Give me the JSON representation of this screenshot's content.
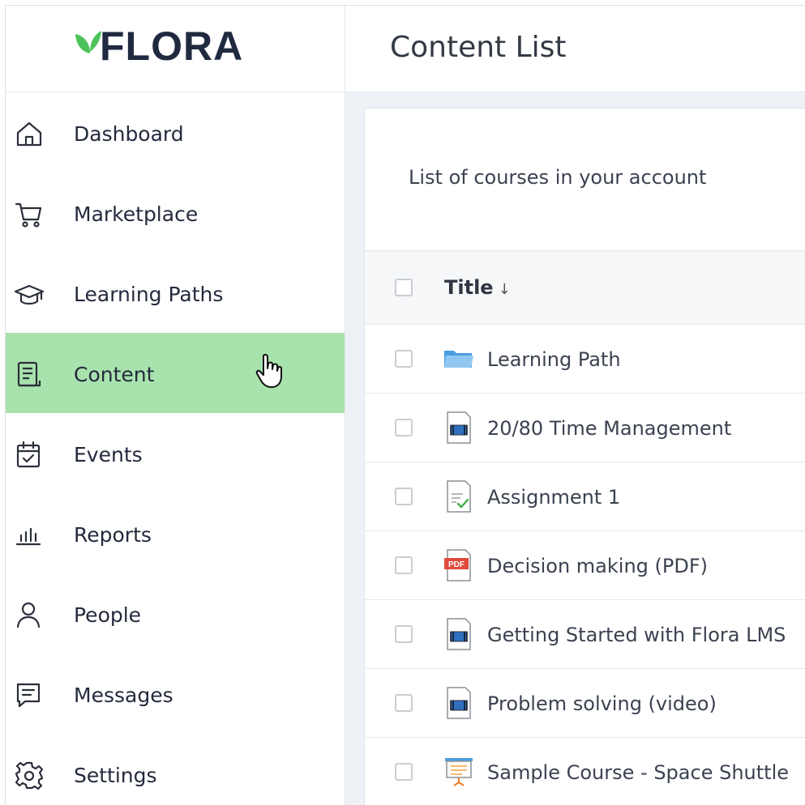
{
  "logo": {
    "text": "FLORA"
  },
  "header": {
    "title": "Content List"
  },
  "sidebar": {
    "items": [
      {
        "label": "Dashboard",
        "icon": "home-icon"
      },
      {
        "label": "Marketplace",
        "icon": "cart-icon"
      },
      {
        "label": "Learning Paths",
        "icon": "graduation-cap-icon"
      },
      {
        "label": "Content",
        "icon": "content-icon",
        "active": true
      },
      {
        "label": "Events",
        "icon": "calendar-check-icon"
      },
      {
        "label": "Reports",
        "icon": "bar-chart-icon"
      },
      {
        "label": "People",
        "icon": "person-icon"
      },
      {
        "label": "Messages",
        "icon": "message-icon"
      },
      {
        "label": "Settings",
        "icon": "gear-icon"
      }
    ]
  },
  "card": {
    "description": "List of courses in your account"
  },
  "table": {
    "column_title": "Title",
    "sort_indicator": "↓",
    "rows": [
      {
        "title": "Learning Path",
        "icon": "folder-icon"
      },
      {
        "title": "20/80 Time Management",
        "icon": "video-file-icon"
      },
      {
        "title": "Assignment 1",
        "icon": "assignment-icon"
      },
      {
        "title": "Decision making (PDF)",
        "icon": "pdf-file-icon"
      },
      {
        "title": "Getting Started with Flora LMS",
        "icon": "video-file-icon"
      },
      {
        "title": "Problem solving (video)",
        "icon": "video-file-icon"
      },
      {
        "title": "Sample Course - Space Shuttle",
        "icon": "presentation-icon"
      }
    ]
  },
  "colors": {
    "active_nav_bg": "#a8e2ad",
    "logo_green": "#4cc35a",
    "logo_text": "#1f2940",
    "pdf_red": "#e04a3b",
    "folder_blue": "#6bb3e8"
  }
}
